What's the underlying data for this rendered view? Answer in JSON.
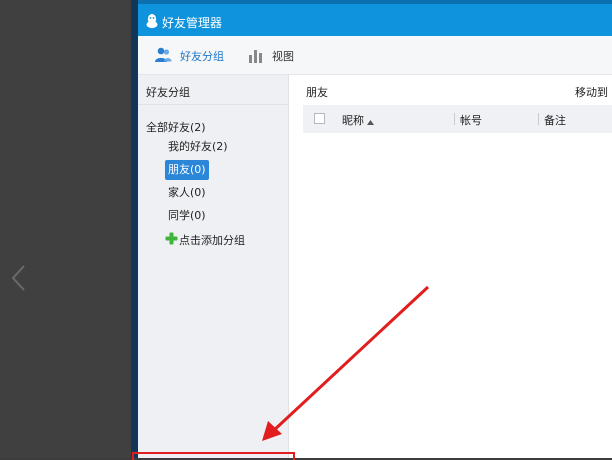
{
  "window": {
    "title": "好友管理器"
  },
  "toolbar": {
    "groups_label": "好友分组",
    "view_label": "视图"
  },
  "sidebar": {
    "header": "好友分组",
    "root": "全部好友(2)",
    "items": [
      {
        "label": "我的好友(2)",
        "selected": false
      },
      {
        "label": "朋友(0)",
        "selected": true
      },
      {
        "label": "家人(0)",
        "selected": false
      },
      {
        "label": "同学(0)",
        "selected": false
      }
    ],
    "add_group": "点击添加分组"
  },
  "main": {
    "group_title": "朋友",
    "move_to": "移动到",
    "columns": {
      "nickname": "昵称",
      "account": "帐号",
      "note": "备注"
    }
  },
  "colors": {
    "titlebar": "#0f93dc",
    "accent": "#1c76c8",
    "selected_bg": "#2b86d8",
    "annotation_red": "#e21d1d",
    "plus_green": "#3fb33a"
  },
  "icons": {
    "title": "qq-penguin-icon",
    "groups": "users-icon",
    "view": "bar-chart-icon",
    "add": "plus-icon",
    "sort": "sort-ascending-icon",
    "back": "chevron-left-icon"
  }
}
